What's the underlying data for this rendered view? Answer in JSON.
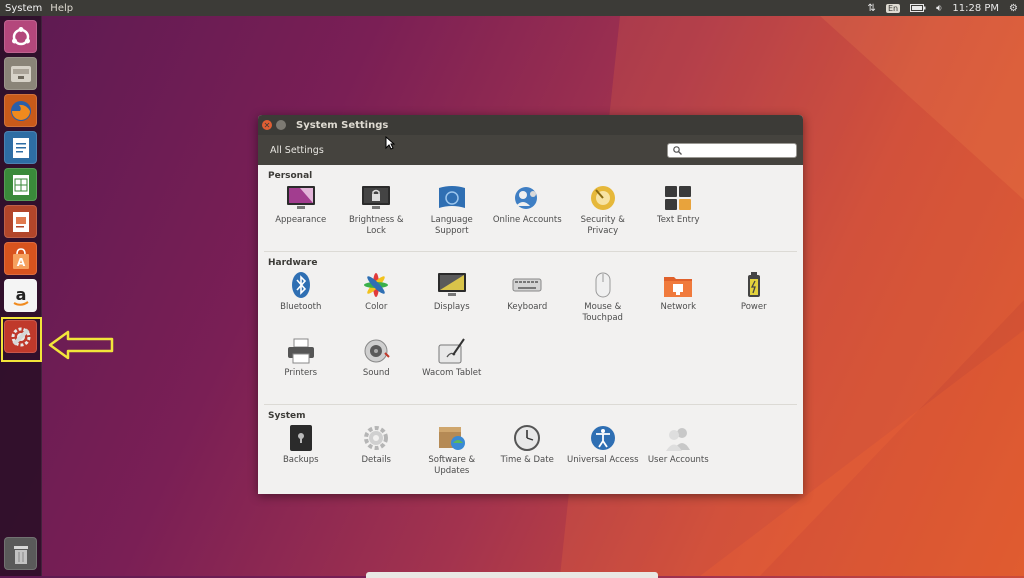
{
  "top_panel": {
    "menus": [
      "System",
      "Help"
    ],
    "keyboard_layout": "En",
    "time": "11:28 PM",
    "icons": [
      "network-updown-icon",
      "battery-icon",
      "volume-icon",
      "gear-icon"
    ]
  },
  "launcher": {
    "items": [
      {
        "name": "dash-home",
        "icon": "ubuntu-logo-icon"
      },
      {
        "name": "files",
        "icon": "file-cabinet-icon"
      },
      {
        "name": "firefox",
        "icon": "firefox-icon"
      },
      {
        "name": "writer",
        "icon": "libreoffice-writer-icon"
      },
      {
        "name": "calc",
        "icon": "libreoffice-calc-icon"
      },
      {
        "name": "impress",
        "icon": "libreoffice-impress-icon"
      },
      {
        "name": "software-center",
        "icon": "shopping-bag-icon"
      },
      {
        "name": "amazon",
        "icon": "amazon-icon"
      },
      {
        "name": "system-settings",
        "icon": "settings-wrench-icon"
      },
      {
        "name": "trash",
        "icon": "trash-icon"
      }
    ]
  },
  "window": {
    "title": "System Settings",
    "toolbar": {
      "all_settings_label": "All Settings",
      "search_value": "",
      "search_placeholder": ""
    },
    "sections": [
      {
        "title": "Personal",
        "items": [
          {
            "label": "Appearance",
            "icon": "appearance-monitor-icon"
          },
          {
            "label": "Brightness & Lock",
            "icon": "lock-monitor-icon"
          },
          {
            "label": "Language Support",
            "icon": "language-flag-icon"
          },
          {
            "label": "Online Accounts",
            "icon": "online-accounts-icon"
          },
          {
            "label": "Security & Privacy",
            "icon": "security-privacy-icon"
          },
          {
            "label": "Text Entry",
            "icon": "text-entry-keyboard-icon"
          }
        ]
      },
      {
        "title": "Hardware",
        "items": [
          {
            "label": "Bluetooth",
            "icon": "bluetooth-icon"
          },
          {
            "label": "Color",
            "icon": "color-icon"
          },
          {
            "label": "Displays",
            "icon": "displays-icon"
          },
          {
            "label": "Keyboard",
            "icon": "keyboard-icon"
          },
          {
            "label": "Mouse & Touchpad",
            "icon": "mouse-icon"
          },
          {
            "label": "Network",
            "icon": "network-folder-icon"
          },
          {
            "label": "Power",
            "icon": "power-battery-icon"
          },
          {
            "label": "Printers",
            "icon": "printer-icon"
          },
          {
            "label": "Sound",
            "icon": "sound-speaker-icon"
          },
          {
            "label": "Wacom Tablet",
            "icon": "wacom-tablet-icon"
          }
        ]
      },
      {
        "title": "System",
        "items": [
          {
            "label": "Backups",
            "icon": "backups-safe-icon"
          },
          {
            "label": "Details",
            "icon": "details-gear-icon"
          },
          {
            "label": "Software & Updates",
            "icon": "software-updates-icon"
          },
          {
            "label": "Time & Date",
            "icon": "clock-icon"
          },
          {
            "label": "Universal Access",
            "icon": "universal-access-icon"
          },
          {
            "label": "User Accounts",
            "icon": "user-accounts-icon"
          }
        ]
      }
    ]
  }
}
